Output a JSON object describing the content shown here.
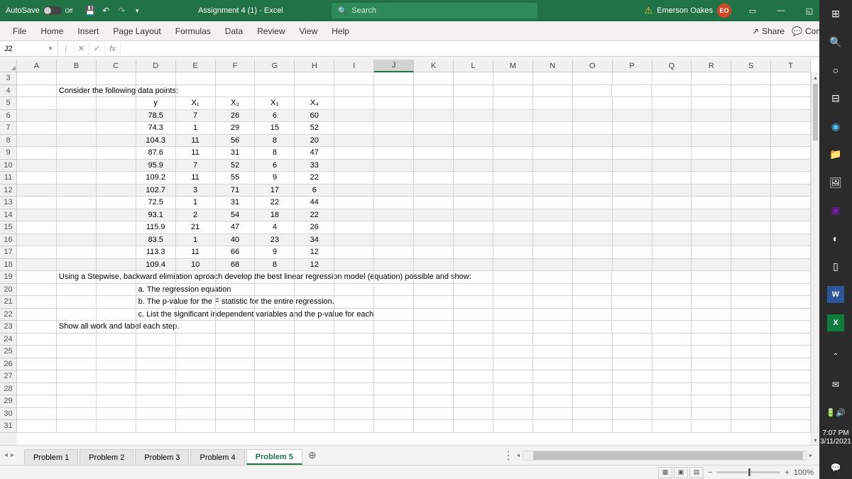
{
  "titlebar": {
    "autosave_label": "AutoSave",
    "autosave_state": "Off",
    "doc_title": "Assignment 4 (1) - Excel",
    "search_placeholder": "Search",
    "user_name": "Emerson Oakes",
    "user_initials": "EO"
  },
  "ribbon": {
    "tabs": [
      "File",
      "Home",
      "Insert",
      "Page Layout",
      "Formulas",
      "Data",
      "Review",
      "View",
      "Help"
    ],
    "share": "Share",
    "comments": "Comments"
  },
  "formula": {
    "namebox": "J2",
    "value": ""
  },
  "columns": [
    "A",
    "B",
    "C",
    "D",
    "E",
    "F",
    "G",
    "H",
    "I",
    "J",
    "K",
    "L",
    "M",
    "N",
    "O",
    "P",
    "Q",
    "R",
    "S",
    "T"
  ],
  "row_start": 3,
  "row_end": 31,
  "selected_cell": {
    "col": "J",
    "row_index_from_start": -1
  },
  "content": {
    "heading": "Consider the following data points:",
    "table_header": [
      "y",
      "X₁",
      "X₂",
      "X₃",
      "X₄"
    ],
    "table_rows": [
      [
        "78.5",
        "7",
        "26",
        "6",
        "60"
      ],
      [
        "74.3",
        "1",
        "29",
        "15",
        "52"
      ],
      [
        "104.3",
        "11",
        "56",
        "8",
        "20"
      ],
      [
        "87.6",
        "11",
        "31",
        "8",
        "47"
      ],
      [
        "95.9",
        "7",
        "52",
        "6",
        "33"
      ],
      [
        "109.2",
        "11",
        "55",
        "9",
        "22"
      ],
      [
        "102.7",
        "3",
        "71",
        "17",
        "6"
      ],
      [
        "72.5",
        "1",
        "31",
        "22",
        "44"
      ],
      [
        "93.1",
        "2",
        "54",
        "18",
        "22"
      ],
      [
        "115.9",
        "21",
        "47",
        "4",
        "26"
      ],
      [
        "83.5",
        "1",
        "40",
        "23",
        "34"
      ],
      [
        "113.3",
        "11",
        "66",
        "9",
        "12"
      ],
      [
        "109.4",
        "10",
        "68",
        "8",
        "12"
      ]
    ],
    "instr1": "Using a Stepwise, backward elimiation aproach develop the best linear regression model (equation) possible and show:",
    "instr_a": "a. The regression equation",
    "instr_b": "b. The p-value for the F statistic for the entire regression.",
    "instr_c": "c. List the significant independent variables and the p-value for each",
    "instr2": "Show all work and label each step."
  },
  "sheets": {
    "tabs": [
      "Problem 1",
      "Problem 2",
      "Problem 3",
      "Problem 4",
      "Problem 5"
    ],
    "active_index": 4
  },
  "status": {
    "zoom": "100%"
  },
  "taskbar": {
    "time": "7:07 PM",
    "date": "3/11/2021"
  }
}
